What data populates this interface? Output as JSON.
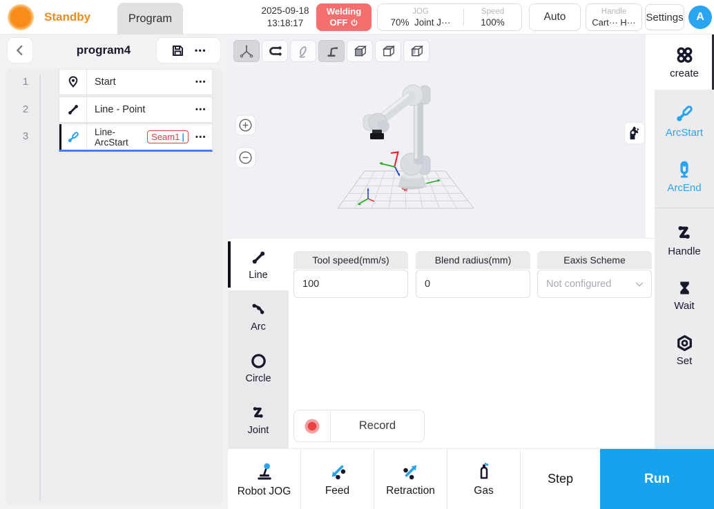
{
  "colors": {
    "accent_blue": "#18a2ee",
    "icon_blue": "#29a3f0",
    "brand_orange": "#ef8b1c",
    "welding_off_red": "#f56f6f",
    "seam_badge_red": "#d84040",
    "selected_underline_blue": "#4a7de5"
  },
  "topbar": {
    "status_label": "Standby",
    "program_tab": "Program",
    "date": "2025-09-18",
    "time": "13:18:17",
    "welding_title": "Welding",
    "welding_state": "OFF",
    "jog_label": "JOG",
    "jog_percent": "70%",
    "jog_mode": "Joint J···",
    "speed_label": "Speed",
    "speed_percent": "100%",
    "auto_button": "Auto",
    "handle_label": "Handle",
    "handle_value_1": "Cart···",
    "handle_value_2": "H···",
    "settings_button": "Settings",
    "avatar_initial": "A"
  },
  "program_panel": {
    "title": "program4",
    "menu_dots": "•••",
    "rows": [
      {
        "num": "1",
        "label": "Start"
      },
      {
        "num": "2",
        "label": "Line - Point"
      },
      {
        "num": "3",
        "label": "Line-ArcStart",
        "badge": "Seam1",
        "cursor": "|"
      }
    ]
  },
  "motion_panel": {
    "tabs": [
      {
        "label": "Line"
      },
      {
        "label": "Arc"
      },
      {
        "label": "Circle"
      },
      {
        "label": "Joint"
      }
    ],
    "fields": [
      {
        "label": "Tool speed(mm/s)",
        "value": "100"
      },
      {
        "label": "Blend radius(mm)",
        "value": "0"
      },
      {
        "label": "Eaxis Scheme",
        "value": "Not configured"
      }
    ],
    "record_button": "Record"
  },
  "action_sidebar": {
    "create_label": "create",
    "items": [
      {
        "label": "ArcStart"
      },
      {
        "label": "ArcEnd"
      },
      {
        "label": "Handle"
      },
      {
        "label": "Wait"
      },
      {
        "label": "Set"
      }
    ]
  },
  "bottom_bar": {
    "items": [
      {
        "label": "Robot JOG"
      },
      {
        "label": "Feed"
      },
      {
        "label": "Retraction"
      },
      {
        "label": "Gas"
      }
    ],
    "step_button": "Step",
    "run_button": "Run"
  }
}
